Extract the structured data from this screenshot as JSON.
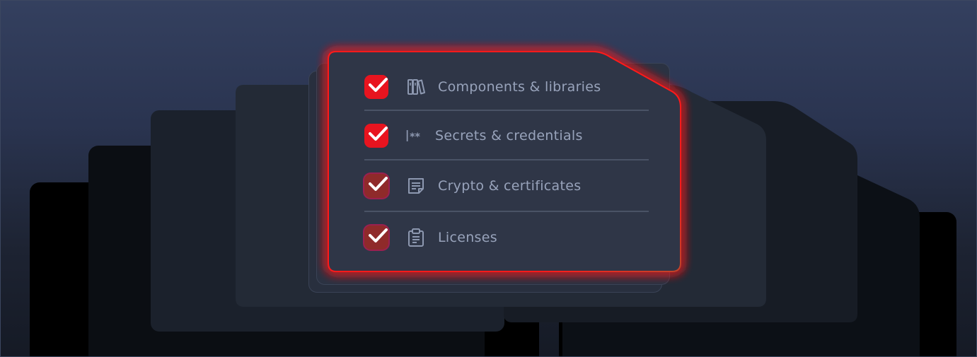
{
  "checklist": {
    "items": [
      {
        "label": "Components & libraries",
        "icon": "books-icon",
        "checked": true
      },
      {
        "label": "Secrets & credentials",
        "icon": "secrets-icon",
        "checked": true
      },
      {
        "label": "Crypto & certificates",
        "icon": "certificate-icon",
        "checked": true
      },
      {
        "label": "Licenses",
        "icon": "clipboard-icon",
        "checked": true
      }
    ]
  },
  "colors": {
    "accent": "#e8141f",
    "glow": "#ff1a1a",
    "card_bg": "#2e3546",
    "text": "#98a3bb",
    "divider": "#4a5366"
  }
}
